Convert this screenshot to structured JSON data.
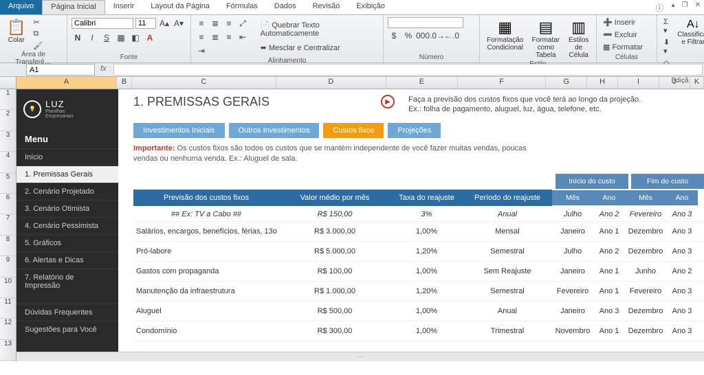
{
  "ribbonTabs": {
    "file": "Arquivo",
    "home": "Página Inicial",
    "insert": "Inserir",
    "layout": "Layout da Página",
    "formulas": "Fórmulas",
    "data": "Dados",
    "review": "Revisão",
    "view": "Exibição"
  },
  "groups": {
    "clipboard": "Área de Transferê…",
    "font": "Fonte",
    "alignment": "Alinhamento",
    "number": "Número",
    "styles": "Estilo",
    "cells": "Células",
    "editing": "Ediçã"
  },
  "clipboard": {
    "paste": "Colar"
  },
  "font": {
    "name": "Calibri",
    "size": "11"
  },
  "alignment": {
    "wrap": "Quebrar Texto Automaticamente",
    "merge": "Mesclar e Centralizar"
  },
  "styles": {
    "cond": "Formatação Condicional",
    "table": "Formatar como Tabela",
    "cell": "Estilos de Célula"
  },
  "cells": {
    "insert": "Inserir",
    "delete": "Excluir",
    "format": "Formatar"
  },
  "editing": {
    "sort": "Classificar e Filtrar"
  },
  "namebox": "A1",
  "cols": [
    "A",
    "B",
    "C",
    "D",
    "E",
    "F",
    "G",
    "H",
    "I",
    "J",
    "K"
  ],
  "rows": [
    "1",
    "2",
    "3",
    "4",
    "5",
    "6",
    "7",
    "8",
    "9",
    "10",
    "11",
    "12",
    "13"
  ],
  "logo": {
    "brand": "LUZ",
    "sub1": "Planilhas",
    "sub2": "Empresariais"
  },
  "menu": {
    "title": "Menu",
    "items": [
      "Início",
      "1. Premissas Gerais",
      "2. Cenário Projetado",
      "3. Cenário Otimista",
      "4. Cenário Pessimista",
      "5. Gráficos",
      "6. Alertas e Dicas",
      "7. Relatório de Impressão"
    ],
    "extras": [
      "Dúvidas Frequentes",
      "Sugestões para Você"
    ]
  },
  "page": {
    "title": "1. PREMISSAS GERAIS",
    "hint1": "Faça a previsão dos custos fixos que você terá ao longo da projeção.",
    "hint2": "Ex.: folha de pagamento, aluguel, luz, água, telefone, etc.",
    "btns": [
      "Investimentos Iniciais",
      "Outros Investimentos",
      "Custos fixos",
      "Projeções"
    ],
    "noteLabel": "Importante:",
    "note": " Os custos fixos são todos os custos que se mantém independente de você fazer muitas vendas, poucas vendas ou nenhuma venda. Ex.: Aluguel de sala."
  },
  "table": {
    "top": {
      "start": "Início do custo",
      "end": "Fim do custo"
    },
    "headers": {
      "prev": "Previsão dos custos fixos",
      "val": "Valor médio por mês",
      "taxa": "Taxa do reajuste",
      "per": "Período do reajuste",
      "mes": "Mês",
      "ano": "Ano"
    },
    "example": {
      "c": "## Ex:  TV a Cabo ##",
      "d": "R$ 150,00",
      "e": "3%",
      "f": "Anual",
      "g": "Julho",
      "h": "Ano 2",
      "i": "Fevereiro",
      "j": "Ano 3"
    },
    "rows": [
      {
        "c": "Salários, encargos, benefícios, férias, 13o",
        "d": "R$ 3.000,00",
        "e": "1,00%",
        "f": "Mensal",
        "g": "Janeiro",
        "h": "Ano 1",
        "i": "Dezembro",
        "j": "Ano 3"
      },
      {
        "c": "Pró-labore",
        "d": "R$ 5.000,00",
        "e": "1,20%",
        "f": "Semestral",
        "g": "Julho",
        "h": "Ano 2",
        "i": "Dezembro",
        "j": "Ano 3"
      },
      {
        "c": "Gastos com propaganda",
        "d": "R$ 100,00",
        "e": "1,00%",
        "f": "Sem Reajuste",
        "g": "Janeiro",
        "h": "Ano 1",
        "i": "Junho",
        "j": "Ano 2"
      },
      {
        "c": "Manutenção da infraestrutura",
        "d": "R$ 1.000,00",
        "e": "1,20%",
        "f": "Semestral",
        "g": "Fevereiro",
        "h": "Ano 1",
        "i": "Fevereiro",
        "j": "Ano 3"
      },
      {
        "c": "Aluguel",
        "d": "R$ 500,00",
        "e": "1,00%",
        "f": "Anual",
        "g": "Janeiro",
        "h": "Ano 3",
        "i": "Dezembro",
        "j": "Ano 3"
      },
      {
        "c": "Condomínio",
        "d": "R$ 300,00",
        "e": "1,00%",
        "f": "Trimestral",
        "g": "Novembro",
        "h": "Ano 1",
        "i": "Dezembro",
        "j": "Ano 3"
      }
    ]
  }
}
